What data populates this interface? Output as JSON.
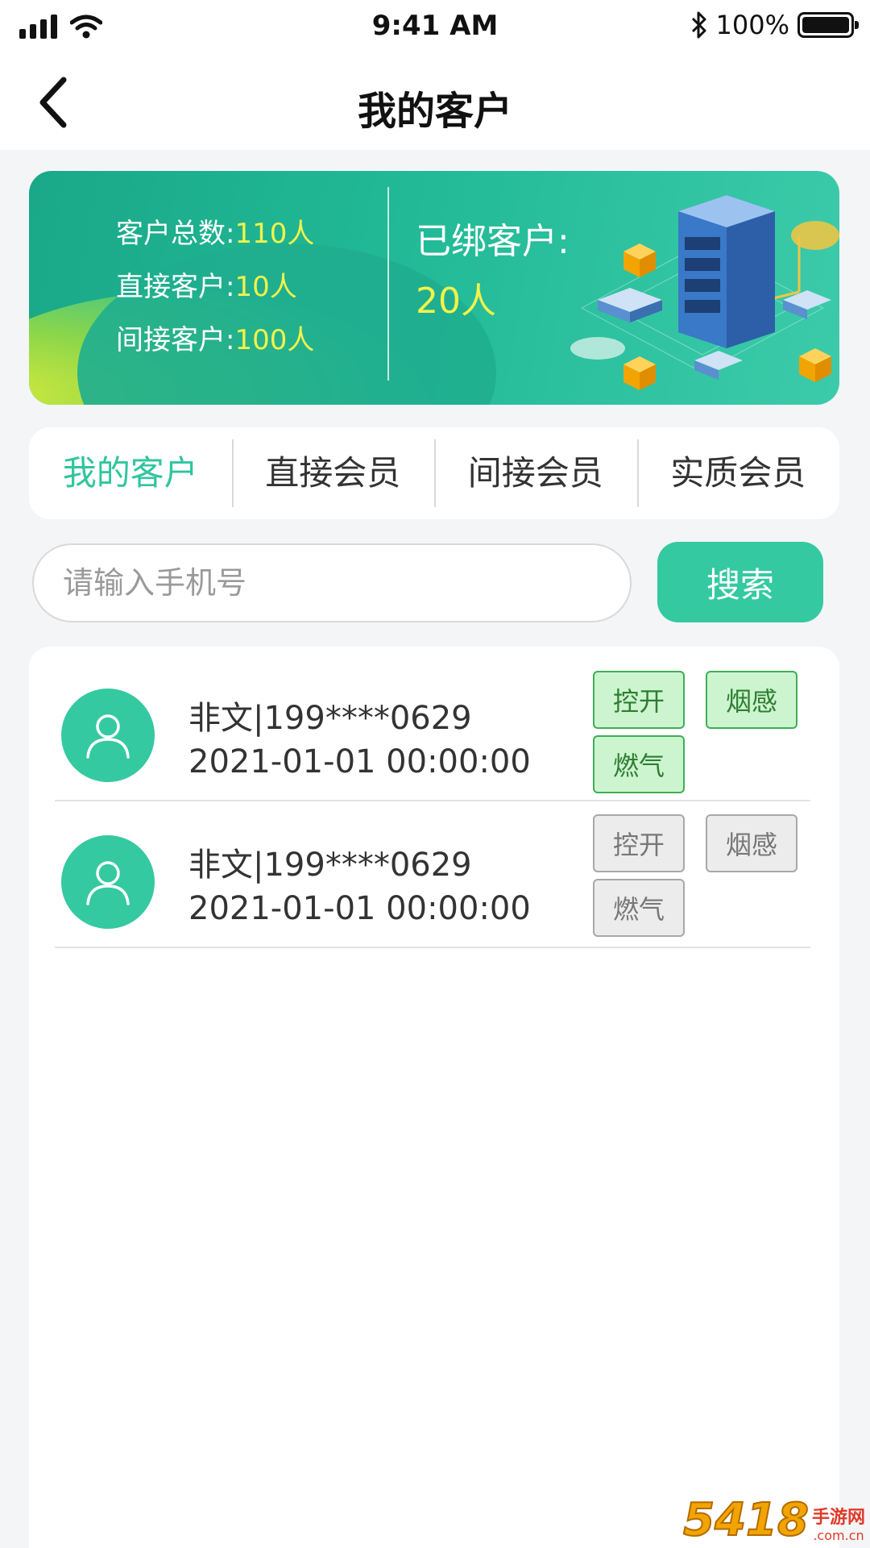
{
  "status_bar": {
    "time": "9:41 AM",
    "battery": "100%",
    "icons": [
      "signal-icon",
      "wifi-icon",
      "bluetooth-icon",
      "battery-icon"
    ]
  },
  "nav": {
    "title": "我的客户",
    "back_icon": "chevron-left-icon"
  },
  "banner": {
    "stats": [
      {
        "label": "客户总数:",
        "value": "110人"
      },
      {
        "label": "直接客户:",
        "value": "10人"
      },
      {
        "label": "间接客户:",
        "value": "100人"
      }
    ],
    "bound_label": "已绑客户:",
    "bound_value": "20人",
    "colors": {
      "accent_yellow": "#f2f24a",
      "bg_green": "#21b996"
    }
  },
  "tabs": [
    {
      "label": "我的客户",
      "active": true
    },
    {
      "label": "直接会员",
      "active": false
    },
    {
      "label": "间接会员",
      "active": false
    },
    {
      "label": "实质会员",
      "active": false
    }
  ],
  "search": {
    "placeholder": "请输入手机号",
    "value": "",
    "button_label": "搜索"
  },
  "customers": [
    {
      "name": "非文|199****0629",
      "date": "2021-01-01  00:00:00",
      "avatar_icon": "user-icon",
      "tags": [
        {
          "label": "控开",
          "active": true
        },
        {
          "label": "烟感",
          "active": true
        },
        {
          "label": "燃气",
          "active": true
        }
      ]
    },
    {
      "name": "非文|199****0629",
      "date": "2021-01-01  00:00:00",
      "avatar_icon": "user-icon",
      "tags": [
        {
          "label": "控开",
          "active": false
        },
        {
          "label": "烟感",
          "active": false
        },
        {
          "label": "燃气",
          "active": false
        }
      ]
    }
  ],
  "watermark": {
    "num": "5418",
    "cn": "手游网",
    "domain": ".com.cn"
  },
  "theme": {
    "primary": "#34c9a1",
    "tag_on_bg": "#ccf5cf",
    "tag_on_border": "#3fae55",
    "tag_off_bg": "#ececec"
  }
}
